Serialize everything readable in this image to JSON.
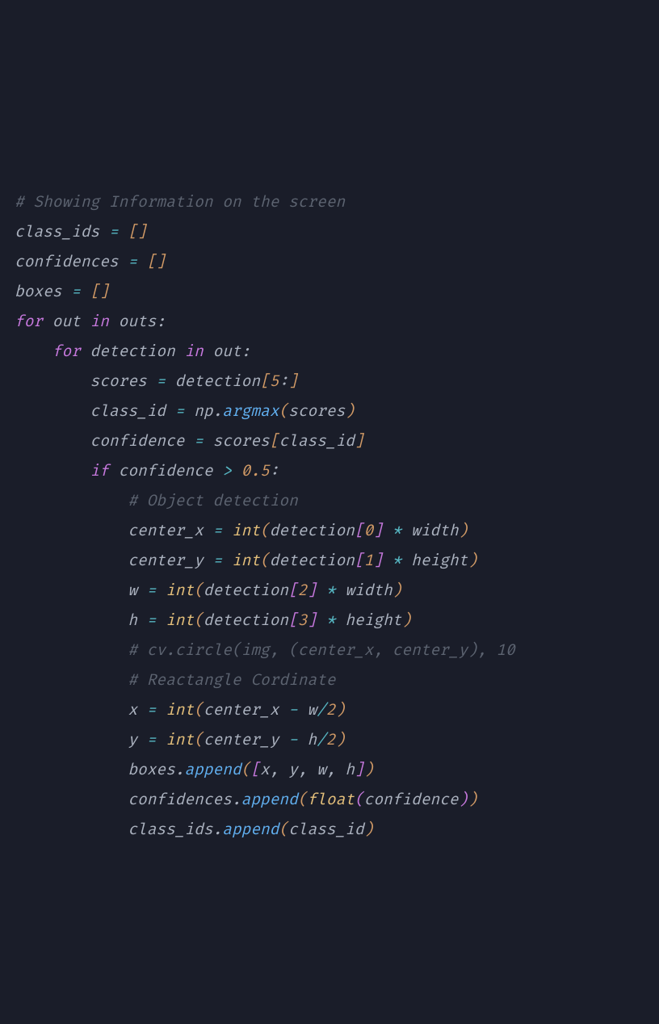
{
  "code": {
    "lines": [
      {
        "indent": 0,
        "tokens": [
          {
            "cls": "comment",
            "t": "# Showing Information on the screen"
          }
        ]
      },
      {
        "indent": 0,
        "tokens": [
          {
            "cls": "var2",
            "t": "class_ids "
          },
          {
            "cls": "operator",
            "t": "="
          },
          {
            "cls": "var2",
            "t": " "
          },
          {
            "cls": "bracket1",
            "t": "[]"
          }
        ]
      },
      {
        "indent": 0,
        "tokens": [
          {
            "cls": "var2",
            "t": "confidences "
          },
          {
            "cls": "operator",
            "t": "="
          },
          {
            "cls": "var2",
            "t": " "
          },
          {
            "cls": "bracket1",
            "t": "[]"
          }
        ]
      },
      {
        "indent": 0,
        "tokens": [
          {
            "cls": "var2",
            "t": "boxes "
          },
          {
            "cls": "operator",
            "t": "="
          },
          {
            "cls": "var2",
            "t": " "
          },
          {
            "cls": "bracket1",
            "t": "[]"
          }
        ]
      },
      {
        "indent": 0,
        "tokens": [
          {
            "cls": "keyword",
            "t": "for"
          },
          {
            "cls": "var2",
            "t": " out "
          },
          {
            "cls": "keyword",
            "t": "in"
          },
          {
            "cls": "var2",
            "t": " outs"
          },
          {
            "cls": "punct",
            "t": ":"
          }
        ]
      },
      {
        "indent": 1,
        "tokens": [
          {
            "cls": "keyword",
            "t": "for"
          },
          {
            "cls": "var2",
            "t": " detection "
          },
          {
            "cls": "keyword",
            "t": "in"
          },
          {
            "cls": "var2",
            "t": " out"
          },
          {
            "cls": "punct",
            "t": ":"
          }
        ]
      },
      {
        "indent": 2,
        "tokens": [
          {
            "cls": "var2",
            "t": "scores "
          },
          {
            "cls": "operator",
            "t": "="
          },
          {
            "cls": "var2",
            "t": " detection"
          },
          {
            "cls": "bracket1",
            "t": "["
          },
          {
            "cls": "number",
            "t": "5"
          },
          {
            "cls": "punct",
            "t": ":"
          },
          {
            "cls": "bracket1",
            "t": "]"
          }
        ]
      },
      {
        "indent": 2,
        "tokens": [
          {
            "cls": "var2",
            "t": "class_id "
          },
          {
            "cls": "operator",
            "t": "="
          },
          {
            "cls": "var2",
            "t": " np"
          },
          {
            "cls": "punct",
            "t": "."
          },
          {
            "cls": "function",
            "t": "argmax"
          },
          {
            "cls": "bracket1",
            "t": "("
          },
          {
            "cls": "var2",
            "t": "scores"
          },
          {
            "cls": "bracket1",
            "t": ")"
          }
        ]
      },
      {
        "indent": 2,
        "tokens": [
          {
            "cls": "var2",
            "t": "confidence "
          },
          {
            "cls": "operator",
            "t": "="
          },
          {
            "cls": "var2",
            "t": " scores"
          },
          {
            "cls": "bracket1",
            "t": "["
          },
          {
            "cls": "var2",
            "t": "class_id"
          },
          {
            "cls": "bracket1",
            "t": "]"
          }
        ]
      },
      {
        "indent": 2,
        "tokens": [
          {
            "cls": "keyword",
            "t": "if"
          },
          {
            "cls": "var2",
            "t": " confidence "
          },
          {
            "cls": "operator",
            "t": ">"
          },
          {
            "cls": "var2",
            "t": " "
          },
          {
            "cls": "number",
            "t": "0.5"
          },
          {
            "cls": "punct",
            "t": ":"
          }
        ]
      },
      {
        "indent": 3,
        "tokens": [
          {
            "cls": "comment",
            "t": "# Object detection"
          }
        ]
      },
      {
        "indent": 3,
        "tokens": [
          {
            "cls": "var2",
            "t": "center_x "
          },
          {
            "cls": "operator",
            "t": "="
          },
          {
            "cls": "var2",
            "t": " "
          },
          {
            "cls": "builtin",
            "t": "int"
          },
          {
            "cls": "bracket1",
            "t": "("
          },
          {
            "cls": "var2",
            "t": "detection"
          },
          {
            "cls": "bracket2",
            "t": "["
          },
          {
            "cls": "number",
            "t": "0"
          },
          {
            "cls": "bracket2",
            "t": "]"
          },
          {
            "cls": "var2",
            "t": " "
          },
          {
            "cls": "operator",
            "t": "*"
          },
          {
            "cls": "var2",
            "t": " width"
          },
          {
            "cls": "bracket1",
            "t": ")"
          }
        ]
      },
      {
        "indent": 3,
        "tokens": [
          {
            "cls": "var2",
            "t": "center_y "
          },
          {
            "cls": "operator",
            "t": "="
          },
          {
            "cls": "var2",
            "t": " "
          },
          {
            "cls": "builtin",
            "t": "int"
          },
          {
            "cls": "bracket1",
            "t": "("
          },
          {
            "cls": "var2",
            "t": "detection"
          },
          {
            "cls": "bracket2",
            "t": "["
          },
          {
            "cls": "number",
            "t": "1"
          },
          {
            "cls": "bracket2",
            "t": "]"
          },
          {
            "cls": "var2",
            "t": " "
          },
          {
            "cls": "operator",
            "t": "*"
          },
          {
            "cls": "var2",
            "t": " height"
          },
          {
            "cls": "bracket1",
            "t": ")"
          }
        ]
      },
      {
        "indent": 3,
        "tokens": [
          {
            "cls": "var2",
            "t": "w "
          },
          {
            "cls": "operator",
            "t": "="
          },
          {
            "cls": "var2",
            "t": " "
          },
          {
            "cls": "builtin",
            "t": "int"
          },
          {
            "cls": "bracket1",
            "t": "("
          },
          {
            "cls": "var2",
            "t": "detection"
          },
          {
            "cls": "bracket2",
            "t": "["
          },
          {
            "cls": "number",
            "t": "2"
          },
          {
            "cls": "bracket2",
            "t": "]"
          },
          {
            "cls": "var2",
            "t": " "
          },
          {
            "cls": "operator",
            "t": "*"
          },
          {
            "cls": "var2",
            "t": " width"
          },
          {
            "cls": "bracket1",
            "t": ")"
          }
        ]
      },
      {
        "indent": 3,
        "tokens": [
          {
            "cls": "var2",
            "t": "h "
          },
          {
            "cls": "operator",
            "t": "="
          },
          {
            "cls": "var2",
            "t": " "
          },
          {
            "cls": "builtin",
            "t": "int"
          },
          {
            "cls": "bracket1",
            "t": "("
          },
          {
            "cls": "var2",
            "t": "detection"
          },
          {
            "cls": "bracket2",
            "t": "["
          },
          {
            "cls": "number",
            "t": "3"
          },
          {
            "cls": "bracket2",
            "t": "]"
          },
          {
            "cls": "var2",
            "t": " "
          },
          {
            "cls": "operator",
            "t": "*"
          },
          {
            "cls": "var2",
            "t": " height"
          },
          {
            "cls": "bracket1",
            "t": ")"
          }
        ]
      },
      {
        "indent": 3,
        "tokens": [
          {
            "cls": "comment",
            "t": "# cv.circle(img, (center_x, center_y), 10"
          }
        ]
      },
      {
        "indent": 3,
        "tokens": [
          {
            "cls": "comment",
            "t": "# Reactangle Cordinate"
          }
        ]
      },
      {
        "indent": 3,
        "tokens": [
          {
            "cls": "var2",
            "t": "x "
          },
          {
            "cls": "operator",
            "t": "="
          },
          {
            "cls": "var2",
            "t": " "
          },
          {
            "cls": "builtin",
            "t": "int"
          },
          {
            "cls": "bracket1",
            "t": "("
          },
          {
            "cls": "var2",
            "t": "center_x "
          },
          {
            "cls": "operator",
            "t": "-"
          },
          {
            "cls": "var2",
            "t": " w"
          },
          {
            "cls": "operator",
            "t": "/"
          },
          {
            "cls": "number",
            "t": "2"
          },
          {
            "cls": "bracket1",
            "t": ")"
          }
        ]
      },
      {
        "indent": 3,
        "tokens": [
          {
            "cls": "var2",
            "t": "y "
          },
          {
            "cls": "operator",
            "t": "="
          },
          {
            "cls": "var2",
            "t": " "
          },
          {
            "cls": "builtin",
            "t": "int"
          },
          {
            "cls": "bracket1",
            "t": "("
          },
          {
            "cls": "var2",
            "t": "center_y "
          },
          {
            "cls": "operator",
            "t": "-"
          },
          {
            "cls": "var2",
            "t": " h"
          },
          {
            "cls": "operator",
            "t": "/"
          },
          {
            "cls": "number",
            "t": "2"
          },
          {
            "cls": "bracket1",
            "t": ")"
          }
        ]
      },
      {
        "indent": 3,
        "tokens": [
          {
            "cls": "var2",
            "t": "boxes"
          },
          {
            "cls": "punct",
            "t": "."
          },
          {
            "cls": "function",
            "t": "append"
          },
          {
            "cls": "bracket1",
            "t": "("
          },
          {
            "cls": "bracket2",
            "t": "["
          },
          {
            "cls": "var2",
            "t": "x"
          },
          {
            "cls": "punct",
            "t": ","
          },
          {
            "cls": "var2",
            "t": " y"
          },
          {
            "cls": "punct",
            "t": ","
          },
          {
            "cls": "var2",
            "t": " w"
          },
          {
            "cls": "punct",
            "t": ","
          },
          {
            "cls": "var2",
            "t": " h"
          },
          {
            "cls": "bracket2",
            "t": "]"
          },
          {
            "cls": "bracket1",
            "t": ")"
          }
        ]
      },
      {
        "indent": 3,
        "tokens": [
          {
            "cls": "var2",
            "t": "confidences"
          },
          {
            "cls": "punct",
            "t": "."
          },
          {
            "cls": "function",
            "t": "append"
          },
          {
            "cls": "bracket1",
            "t": "("
          },
          {
            "cls": "builtin",
            "t": "float"
          },
          {
            "cls": "bracket2",
            "t": "("
          },
          {
            "cls": "var2",
            "t": "confidence"
          },
          {
            "cls": "bracket2",
            "t": ")"
          },
          {
            "cls": "bracket1",
            "t": ")"
          }
        ]
      },
      {
        "indent": 3,
        "tokens": [
          {
            "cls": "var2",
            "t": "class_ids"
          },
          {
            "cls": "punct",
            "t": "."
          },
          {
            "cls": "function",
            "t": "append"
          },
          {
            "cls": "bracket1",
            "t": "("
          },
          {
            "cls": "var2",
            "t": "class_id"
          },
          {
            "cls": "bracket1",
            "t": ")"
          }
        ]
      }
    ],
    "indent_unit": "    "
  }
}
